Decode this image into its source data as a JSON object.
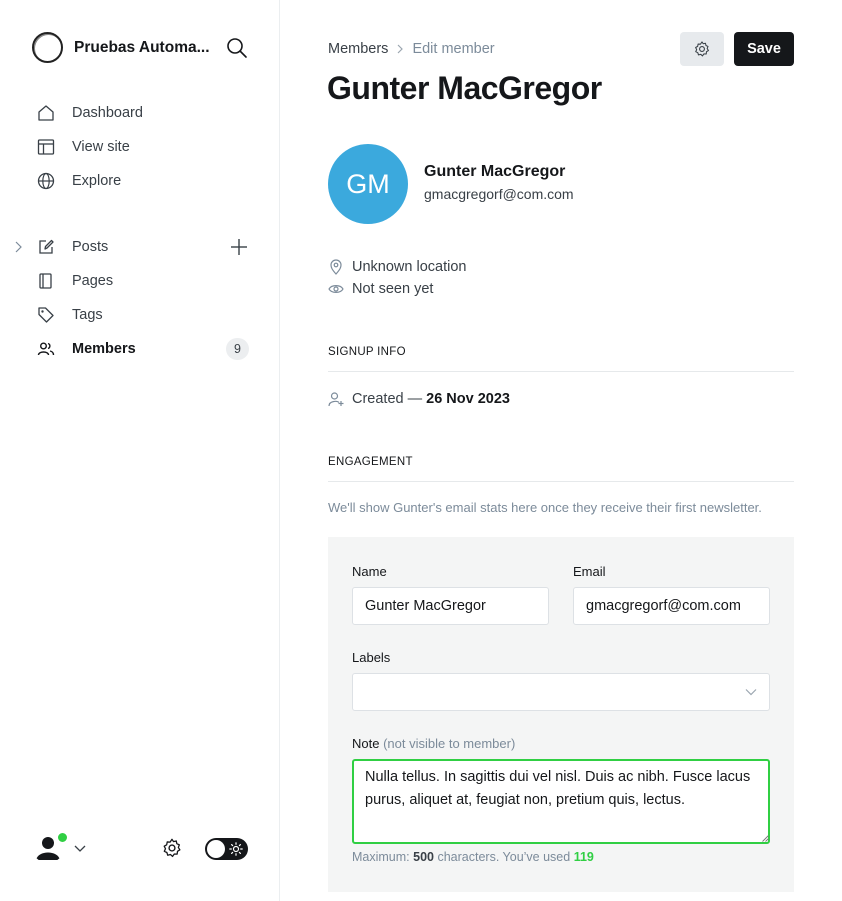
{
  "sidebar": {
    "site_name": "Pruebas Automa...",
    "nav_top": [
      {
        "label": "Dashboard",
        "icon": "home-icon"
      },
      {
        "label": "View site",
        "icon": "layout-icon"
      },
      {
        "label": "Explore",
        "icon": "globe-icon"
      }
    ],
    "nav_content": [
      {
        "label": "Posts",
        "icon": "pencil-square-icon"
      },
      {
        "label": "Pages",
        "icon": "pages-icon"
      },
      {
        "label": "Tags",
        "icon": "tag-icon"
      },
      {
        "label": "Members",
        "icon": "members-icon",
        "badge": "9",
        "active": true
      }
    ]
  },
  "breadcrumb": {
    "parent": "Members",
    "current": "Edit member"
  },
  "header": {
    "title": "Gunter MacGregor",
    "save_label": "Save"
  },
  "member": {
    "initials": "GM",
    "name": "Gunter MacGregor",
    "email": "gmacgregorf@com.com",
    "location": "Unknown location",
    "last_seen": "Not seen yet",
    "avatar_color": "#3ba9dd"
  },
  "signup": {
    "section_title": "SIGNUP INFO",
    "created_label": "Created —",
    "created_date": "26 Nov 2023"
  },
  "engagement": {
    "section_title": "ENGAGEMENT",
    "note": "We'll show Gunter's email stats here once they receive their first newsletter."
  },
  "form": {
    "name_label": "Name",
    "name_value": "Gunter MacGregor",
    "email_label": "Email",
    "email_value": "gmacgregorf@com.com",
    "labels_label": "Labels",
    "note_label": "Note",
    "note_hint": "(not visible to member)",
    "note_value": "Nulla tellus. In sagittis dui vel nisl. Duis ac nibh. Fusce lacus purus, aliquet at, feugiat non, pretium quis, lectus.",
    "max_prefix": "Maximum:",
    "max_chars": "500",
    "used_text": "characters. You’ve used",
    "used_chars": "119"
  },
  "colors": {
    "accent": "#30cf43",
    "dark": "#15171a"
  }
}
